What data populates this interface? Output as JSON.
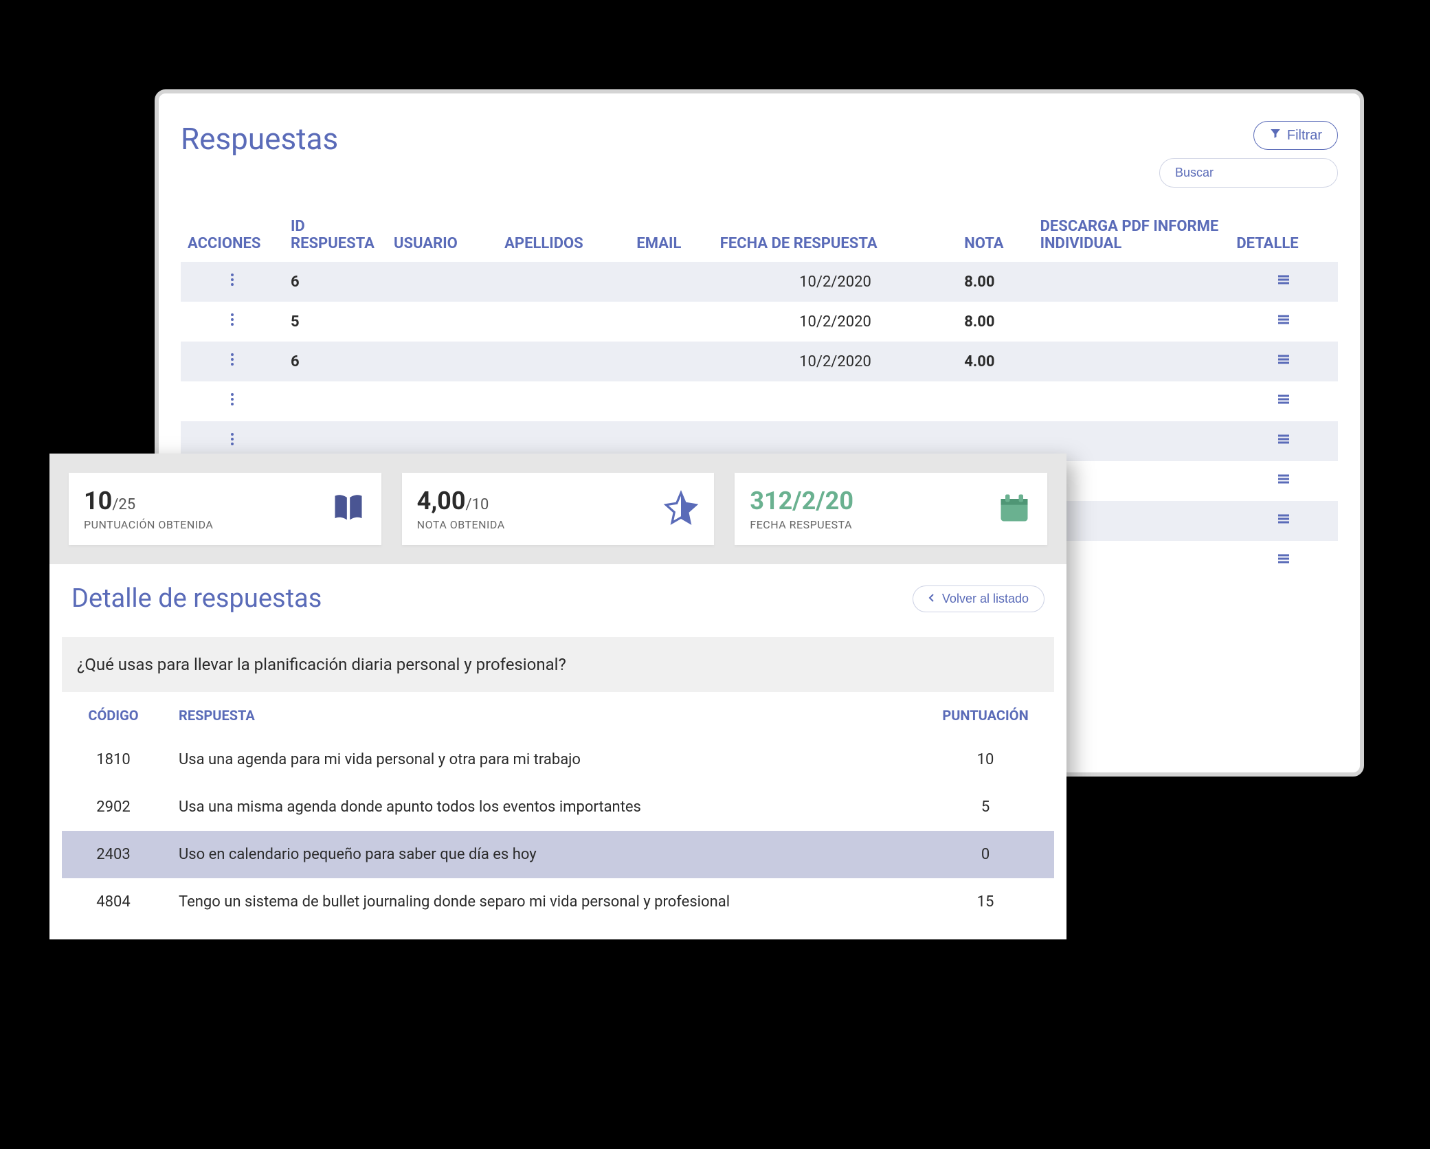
{
  "back": {
    "title": "Respuestas",
    "filter_label": "Filtrar",
    "search_placeholder": "Buscar",
    "columns": {
      "acciones": "ACCIONES",
      "id": "ID RESPUESTA",
      "usuario": "USUARIO",
      "apellidos": "APELLIDOS",
      "email": "EMAIL",
      "fecha": "FECHA DE RESPUESTA",
      "nota": "NOTA",
      "descarga": "DESCARGA PDF INFORME INDIVIDUAL",
      "detalle": "DETALLE"
    },
    "rows": [
      {
        "id": "6",
        "fecha": "10/2/2020",
        "nota": "8.00",
        "nota_color": "green"
      },
      {
        "id": "5",
        "fecha": "10/2/2020",
        "nota": "8.00",
        "nota_color": "green"
      },
      {
        "id": "6",
        "fecha": "10/2/2020",
        "nota": "4.00",
        "nota_color": "red"
      },
      {
        "id": "",
        "fecha": "",
        "nota": "",
        "nota_color": ""
      },
      {
        "id": "",
        "fecha": "",
        "nota": "",
        "nota_color": ""
      },
      {
        "id": "",
        "fecha": "",
        "nota": "",
        "nota_color": ""
      },
      {
        "id": "",
        "fecha": "",
        "nota": "",
        "nota_color": ""
      },
      {
        "id": "",
        "fecha": "",
        "nota": "",
        "nota_color": ""
      }
    ]
  },
  "front": {
    "scores": {
      "puntuacion": {
        "main": "10",
        "sub": "/25",
        "label": "PUNTUACIÓN OBTENIDA"
      },
      "nota": {
        "main": "4,00",
        "sub": "/10",
        "label": "NOTA OBTENIDA"
      },
      "fecha": {
        "main": "312/2/20",
        "sub": "",
        "label": "FECHA RESPUESTA"
      }
    },
    "detail_title": "Detalle de respuestas",
    "back_label": "Volver al listado",
    "question": "¿Qué usas para llevar la planificación diaria personal y profesional?",
    "columns": {
      "codigo": "CÓDIGO",
      "respuesta": "RESPUESTA",
      "puntuacion": "PUNTUACIÓN"
    },
    "rows": [
      {
        "codigo": "1810",
        "respuesta": "Usa una agenda para mi vida personal y otra para mi trabajo",
        "puntuacion": "10",
        "highlight": false
      },
      {
        "codigo": "2902",
        "respuesta": "Usa una misma agenda donde apunto todos los eventos importantes",
        "puntuacion": "5",
        "highlight": false
      },
      {
        "codigo": "2403",
        "respuesta": "Uso en  calendario pequeño para saber que día es hoy",
        "puntuacion": "0",
        "highlight": true
      },
      {
        "codigo": "4804",
        "respuesta": "Tengo un sistema de bullet journaling donde separo mi vida personal y profesional",
        "puntuacion": "15",
        "highlight": false
      }
    ]
  }
}
